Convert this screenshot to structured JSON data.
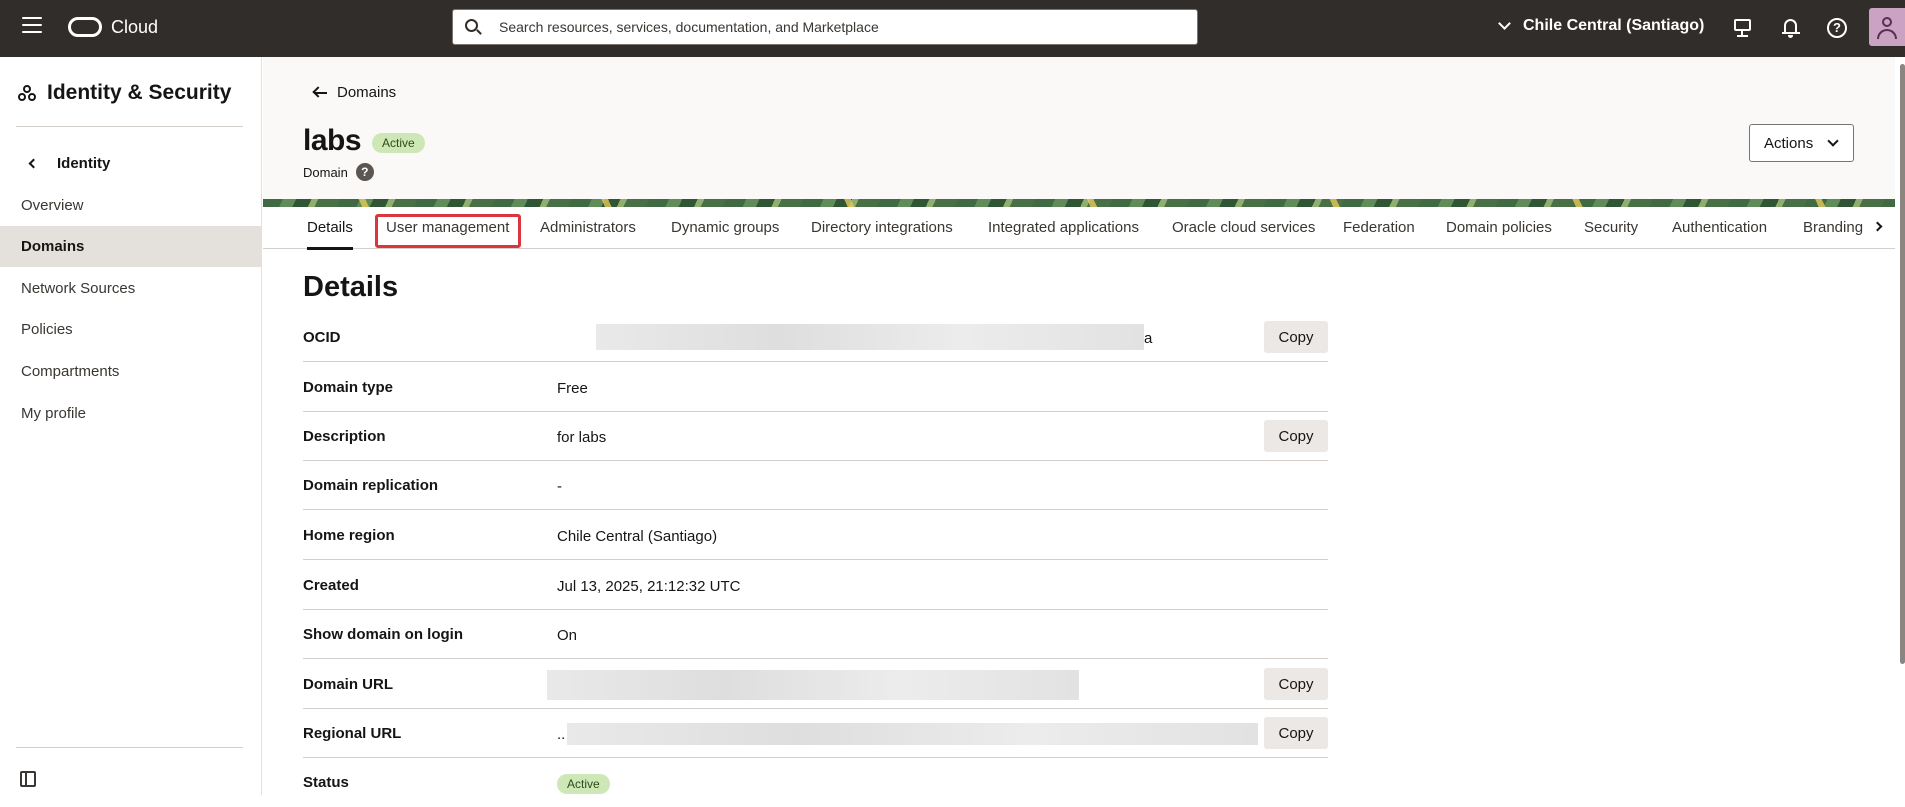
{
  "topbar": {
    "brand": "Cloud",
    "search_placeholder": "Search resources, services, documentation, and Marketplace",
    "region": "Chile Central (Santiago)",
    "help_glyph": "?"
  },
  "sidebar": {
    "title": "Identity & Security",
    "back_label": "Identity",
    "items": [
      {
        "label": "Overview"
      },
      {
        "label": "Domains"
      },
      {
        "label": "Network Sources"
      },
      {
        "label": "Policies"
      },
      {
        "label": "Compartments"
      },
      {
        "label": "My profile"
      }
    ]
  },
  "header": {
    "back_label": "Domains",
    "title": "labs",
    "status": "Active",
    "subtitle": "Domain",
    "help_glyph": "?",
    "actions_label": "Actions"
  },
  "tabs": [
    {
      "label": "Details"
    },
    {
      "label": "User management"
    },
    {
      "label": "Administrators"
    },
    {
      "label": "Dynamic groups"
    },
    {
      "label": "Directory integrations"
    },
    {
      "label": "Integrated applications"
    },
    {
      "label": "Oracle cloud services"
    },
    {
      "label": "Federation"
    },
    {
      "label": "Domain policies"
    },
    {
      "label": "Security"
    },
    {
      "label": "Authentication"
    },
    {
      "label": "Branding"
    }
  ],
  "details": {
    "heading": "Details",
    "copy_label": "Copy",
    "rows": [
      {
        "label": "OCID",
        "value": "a"
      },
      {
        "label": "Domain type",
        "value": "Free"
      },
      {
        "label": "Description",
        "value": "for labs"
      },
      {
        "label": "Domain replication",
        "value": "-"
      },
      {
        "label": "Home region",
        "value": "Chile Central (Santiago)"
      },
      {
        "label": "Created",
        "value": "Jul 13, 2025, 21:12:32 UTC"
      },
      {
        "label": "Show domain on login",
        "value": "On"
      },
      {
        "label": "Domain URL",
        "value": ""
      },
      {
        "label": "Regional URL",
        "value": ".."
      },
      {
        "label": "Status",
        "value": "Active"
      }
    ]
  },
  "colors": {
    "topbar_bg": "#312d2a",
    "active_badge": "#cde8b6",
    "highlight_border": "#d9363e"
  },
  "icons": [
    "hamburger-icon",
    "oracle-logo-icon",
    "search-icon",
    "chevron-down-icon",
    "monitor-icon",
    "bell-icon",
    "help-icon",
    "user-avatar-icon",
    "identity-hub-icon",
    "chevron-left-icon",
    "arrow-left-icon",
    "chevron-right-icon",
    "sidebar-collapse-icon"
  ]
}
